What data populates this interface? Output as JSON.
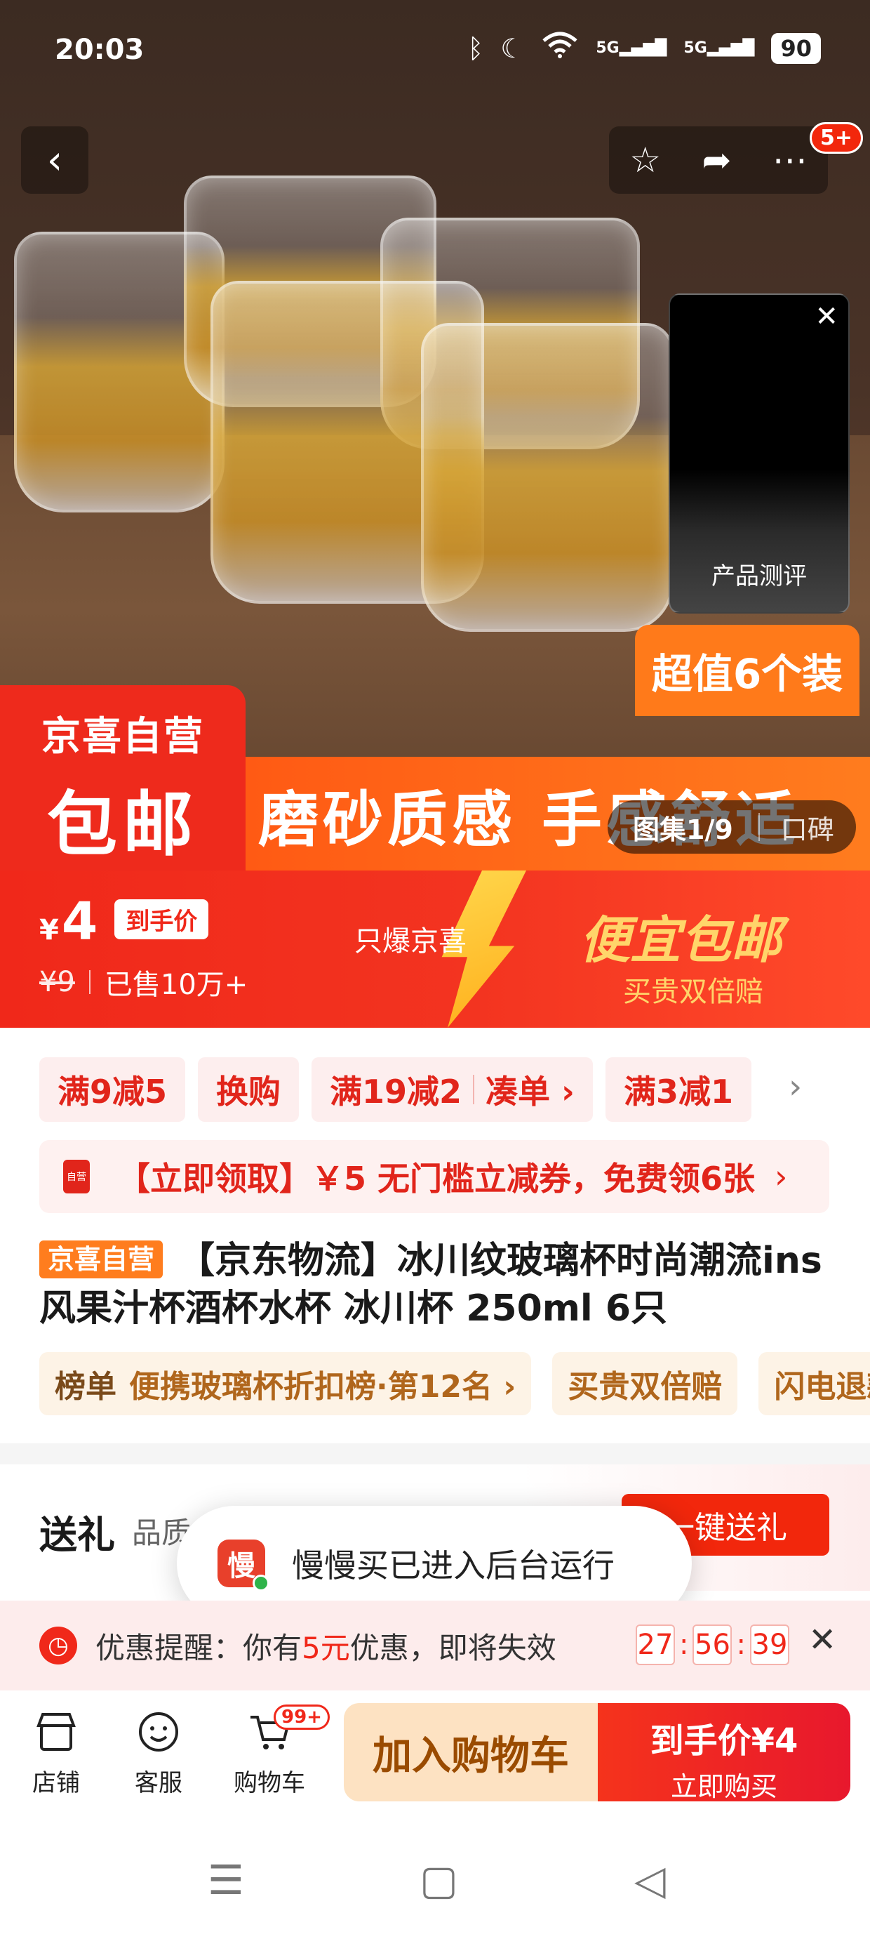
{
  "status_bar": {
    "time": "20:03",
    "network_1": "5G",
    "network_2": "5G",
    "battery": "90"
  },
  "header": {
    "notification_badge": "5+"
  },
  "hero": {
    "review_video_label": "产品测评",
    "value_pack_label": "超值6个装",
    "badge_line1": "京喜自营",
    "badge_line2": "包邮",
    "promo_text": "磨砂质感  手感舒适",
    "gallery_counter": "图集1/9",
    "gallery_alt": "口碑"
  },
  "price": {
    "currency": "¥",
    "value": "4",
    "final_price_label": "到手价",
    "original_price": "¥9",
    "sold_count": "已售10万+",
    "channel_label": "只爆京喜",
    "slogan": "便宜包邮",
    "guarantee": "买贵双倍赔"
  },
  "coupons": [
    {
      "label": "满9减5"
    },
    {
      "label": "换购"
    },
    {
      "label": "满19减2",
      "action": "凑单 ›"
    },
    {
      "label": "满3减1"
    }
  ],
  "voucher": {
    "icon_text": "自营",
    "text": "【立即领取】￥5 无门槛立减券，免费领6张",
    "arrow": "›"
  },
  "product": {
    "tag": "京喜自营",
    "title": "【京东物流】冰川纹玻璃杯时尚潮流ins风果汁杯酒杯水杯 冰川杯 250ml 6只"
  },
  "ranks": [
    {
      "prefix": "榜单",
      "label": "便携玻璃杯折扣榜·第12名 ›"
    },
    {
      "prefix": "",
      "label": "买贵双倍赔"
    },
    {
      "prefix": "",
      "label": "闪电退款"
    }
  ],
  "gift": {
    "title": "送礼",
    "subtitle": "品质",
    "button": "一键送礼"
  },
  "toast": {
    "icon_text": "慢",
    "text": "慢慢买已进入后台运行"
  },
  "reminder": {
    "prefix": "优惠提醒：你有",
    "amount": "5元",
    "suffix": "优惠，即将失效",
    "hours": "27",
    "minutes": "56",
    "seconds": "39"
  },
  "bottom_bar": {
    "shop": "店铺",
    "service": "客服",
    "cart": "购物车",
    "cart_badge": "99+",
    "add_to_cart": "加入购物车",
    "buy_line1": "到手价¥4",
    "buy_line2": "立即购买"
  },
  "colors": {
    "brand_red": "#f0281a",
    "accent_orange": "#ff7a1a",
    "gold": "#ffd56a"
  }
}
